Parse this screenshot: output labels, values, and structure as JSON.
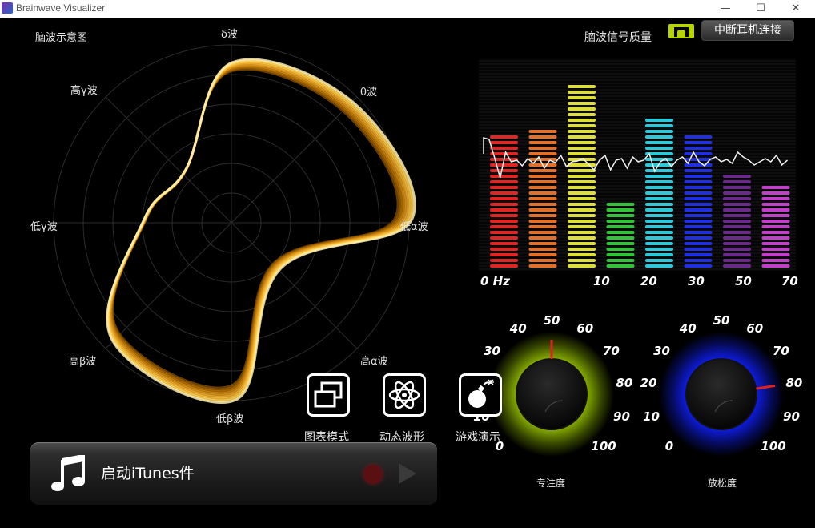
{
  "window": {
    "title": "Brainwave Visualizer",
    "controls": {
      "minimize": "—",
      "maximize": "☐",
      "close": "✕"
    }
  },
  "radar": {
    "title": "脑波示意图",
    "axes": [
      "δ波",
      "θ波",
      "低α波",
      "高α波",
      "低β波",
      "高β波",
      "低γ波",
      "高γ波"
    ]
  },
  "signal": {
    "quality_label": "脑波信号质量",
    "disconnect_label": "中断耳机连接"
  },
  "spectrum": {
    "freq_labels": [
      "0 Hz",
      "10",
      "20",
      "30",
      "50",
      "70"
    ],
    "bars": [
      {
        "color": "#e02525",
        "level": 0.64
      },
      {
        "color": "#e3702a",
        "level": 0.68
      },
      {
        "color": "#dede3a",
        "level": 0.88
      },
      {
        "color": "#33c33a",
        "level": 0.34
      },
      {
        "color": "#2ec8d8",
        "level": 0.72
      },
      {
        "color": "#2030e0",
        "level": 0.65
      },
      {
        "color": "#6a2a8a",
        "level": 0.46
      },
      {
        "color": "#c040c8",
        "level": 0.4
      }
    ]
  },
  "buttons": {
    "chart_mode": "图表模式",
    "dynamic_wave": "动态波形",
    "game_demo": "游戏演示"
  },
  "itunes": {
    "label": "启动iTunes件"
  },
  "gauges": {
    "scale": [
      "0",
      "10",
      "20",
      "30",
      "40",
      "50",
      "60",
      "70",
      "80",
      "90",
      "100"
    ],
    "attention": {
      "label": "专注度",
      "value": 50
    },
    "meditation": {
      "label": "放松度",
      "value": 80
    }
  },
  "colors": {
    "radar_curve": "#ffd24a",
    "attention_glow": "#9ac600",
    "meditation_glow": "#1020ff"
  }
}
